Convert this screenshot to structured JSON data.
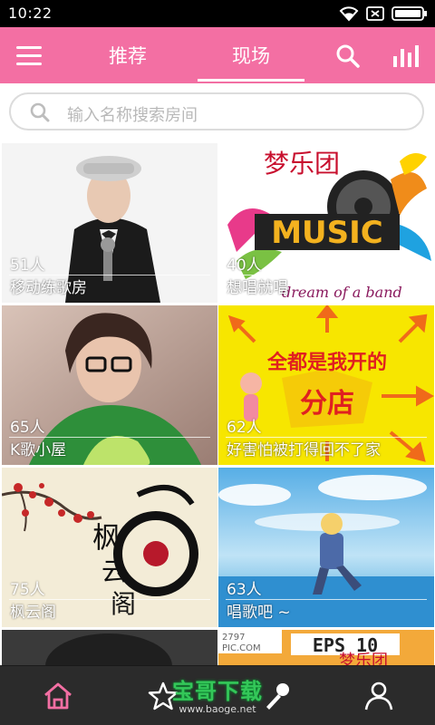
{
  "status_bar": {
    "time": "10:22"
  },
  "header": {
    "tabs": [
      {
        "label": "推荐",
        "active": false
      },
      {
        "label": "现场",
        "active": true
      }
    ],
    "accent_color": "#f36fa3"
  },
  "search": {
    "placeholder": "输入名称搜索房间"
  },
  "rooms": [
    {
      "count": "51人",
      "name": "移动练歌房"
    },
    {
      "count": "40人",
      "name": "想唱就唱",
      "art_text": [
        "梦乐团",
        "MUSIC",
        "dream of a band"
      ]
    },
    {
      "count": "65人",
      "name": "K歌小屋"
    },
    {
      "count": "62人",
      "name": "好害怕被打得回不了家",
      "art_text": [
        "全都是我开的",
        "分店"
      ]
    },
    {
      "count": "75人",
      "name": "枫云阁",
      "art_text": [
        "枫",
        "云",
        "阁"
      ]
    },
    {
      "count": "63人",
      "name": "唱歌吧 ~"
    },
    {
      "count": "",
      "name": ""
    },
    {
      "count": "",
      "name": "",
      "art_text": [
        "2797",
        "PIC.COM",
        "EPS 10",
        "梦乐团"
      ]
    }
  ],
  "bottom_nav": {
    "items": [
      "home-icon",
      "star-icon",
      "microphone-icon",
      "user-icon"
    ],
    "active": "home-icon",
    "active_color": "#f36fa3"
  },
  "watermark": {
    "title": "宝哥下载",
    "url": "www.baoge.net"
  }
}
